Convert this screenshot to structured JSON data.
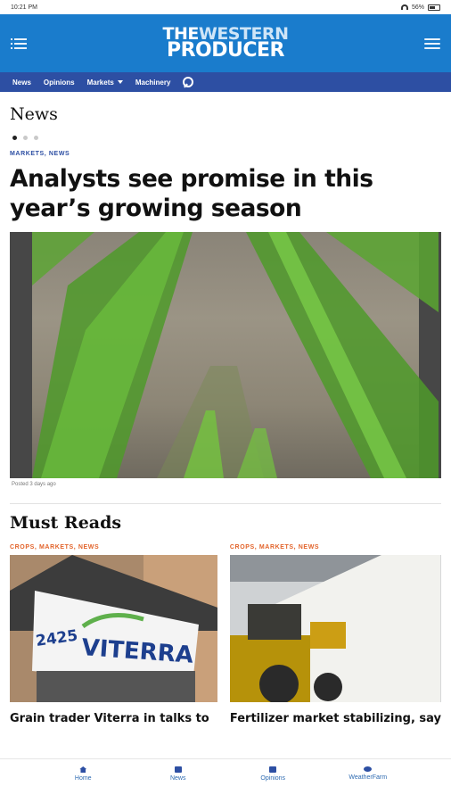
{
  "status": {
    "time": "10:21 PM",
    "battery": "56%"
  },
  "header": {
    "logo_line1_the": "THE",
    "logo_line1_western": "WESTERN",
    "logo_line2": "PRODUCER"
  },
  "nav": {
    "items": [
      "News",
      "Opinions",
      "Markets",
      "Machinery"
    ]
  },
  "news": {
    "section_title": "News",
    "kicker": "MARKETS, NEWS",
    "headline": "Analysts see promise in this year’s growing season",
    "caption": "Posted 3 days ago"
  },
  "must_reads": {
    "section_title": "Must Reads",
    "cards": [
      {
        "kicker": "CROPS, MARKETS, NEWS",
        "title": "Grain trader Viterra in talks to",
        "sign_number": "2425",
        "sign_brand": "VITERRA"
      },
      {
        "kicker": "CROPS, MARKETS, NEWS",
        "title": "Fertilizer market stabilizing, say"
      }
    ]
  },
  "bottom_nav": {
    "tabs": [
      "Home",
      "News",
      "Opinions",
      "WeatherFarm"
    ]
  },
  "colors": {
    "header_blue": "#1a7ccc",
    "nav_blue": "#2d4fa3",
    "kicker_blue": "#2d4fa3",
    "kicker_orange": "#e2632a"
  }
}
